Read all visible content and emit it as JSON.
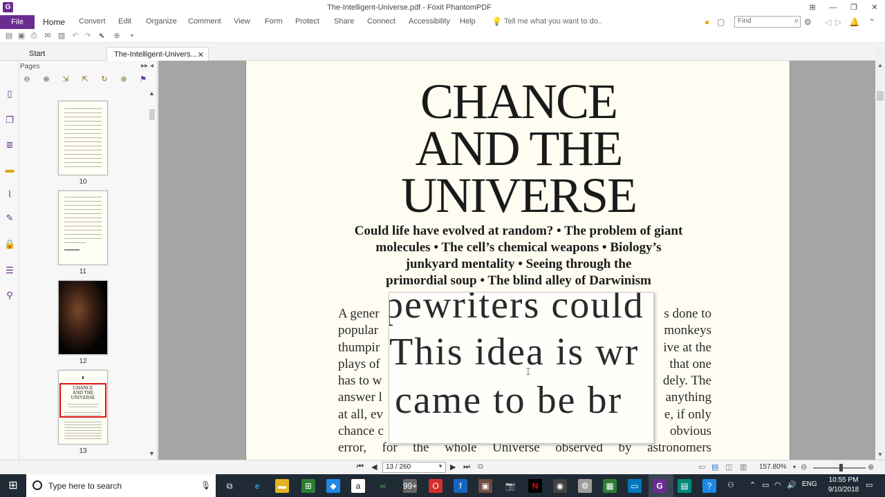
{
  "window": {
    "title": "The-Intelligent-Universe.pdf - Foxit PhantomPDF",
    "app_icon": "G",
    "controls": [
      "⊞",
      "—",
      "❐",
      "✕"
    ]
  },
  "menu": {
    "file": "File",
    "items": [
      "Home",
      "Convert",
      "Edit",
      "Organize",
      "Comment",
      "View",
      "Form",
      "Protect",
      "Share",
      "Connect",
      "Accessibility",
      "Help"
    ],
    "tell_me": "Tell me what you want to do..",
    "find_placeholder": "Find"
  },
  "tabs": {
    "start": "Start",
    "document": "The-Intelligent-Univers...",
    "close": "✕"
  },
  "pages_panel": {
    "title": "Pages",
    "thumbnails": [
      {
        "page": "10"
      },
      {
        "page": "11"
      },
      {
        "page": "12"
      },
      {
        "page": "13",
        "selected": true
      }
    ]
  },
  "document": {
    "title_lines": [
      "CHANCE",
      "AND THE",
      "UNIVERSE"
    ],
    "subtitle_lines": [
      "Could life have evolved at random? • The problem of giant",
      "molecules • The cell’s chemical weapons • Biology’s",
      "junkyard mentality • Seeing through the",
      "primordial soup • The blind alley of Darwinism"
    ],
    "body_left": [
      "A gener",
      "popular",
      "thumpir",
      "plays of",
      "has to w",
      "answer l",
      "at all, ev",
      "chance c"
    ],
    "body_right": [
      "s done to",
      "monkeys",
      "ive at the",
      "that one",
      "dely. The",
      "anything",
      "e, if only",
      "obvious"
    ],
    "body_last": [
      "error,",
      "for",
      "the",
      "whole",
      "Universe",
      "observed",
      "by",
      "astronomers"
    ],
    "magnifier_lines": [
      "pewriters could",
      "This idea is wr",
      "came to be br"
    ]
  },
  "status": {
    "page_indicator": "13 / 260",
    "zoom": "157.80%"
  },
  "taskbar": {
    "search_placeholder": "Type here to search",
    "language": "ENG",
    "time": "10:55 PM",
    "date": "9/10/2018"
  }
}
